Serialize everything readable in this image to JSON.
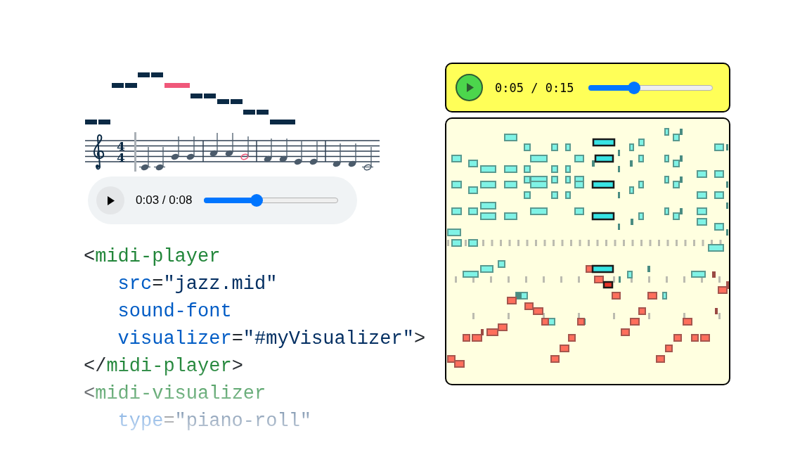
{
  "staff": {
    "time_signature": {
      "beats": "4",
      "beat_unit": "4"
    }
  },
  "score_player": {
    "time": "0:03 / 0:08",
    "level": 0.39
  },
  "code": [
    {
      "kind": "tag",
      "tokens": [
        {
          "kind": "punct",
          "text": "<"
        },
        {
          "kind": "tag",
          "text": "midi-player"
        }
      ]
    },
    {
      "kind": "attribute",
      "tokens": [
        {
          "kind": "attr",
          "text": "src"
        },
        {
          "kind": "punct",
          "text": "="
        },
        {
          "kind": "string",
          "text": "\"jazz.mid\""
        }
      ]
    },
    {
      "kind": "attribute",
      "tokens": [
        {
          "kind": "attr",
          "text": "sound-font"
        }
      ]
    },
    {
      "kind": "attribute",
      "tokens": [
        {
          "kind": "attr",
          "text": "visualizer"
        },
        {
          "kind": "punct",
          "text": "="
        },
        {
          "kind": "string",
          "text": "\"#myVisualizer\""
        },
        {
          "kind": "punct",
          "text": ">"
        }
      ]
    },
    {
      "kind": "tag",
      "tokens": [
        {
          "kind": "punct",
          "text": "</"
        },
        {
          "kind": "tag",
          "text": "midi-player"
        },
        {
          "kind": "punct",
          "text": ">"
        }
      ]
    },
    {
      "kind": "tag",
      "tokens": [
        {
          "kind": "punct",
          "text": "<"
        },
        {
          "kind": "tag",
          "text": "midi-visualizer"
        }
      ]
    },
    {
      "kind": "attribute",
      "tokens": [
        {
          "kind": "attr",
          "text": "type"
        },
        {
          "kind": "punct",
          "text": "="
        },
        {
          "kind": "string",
          "text": "\"piano-roll\""
        }
      ]
    }
  ],
  "roll_player": {
    "time": "0:05 / 0:15",
    "level": 0.37
  }
}
